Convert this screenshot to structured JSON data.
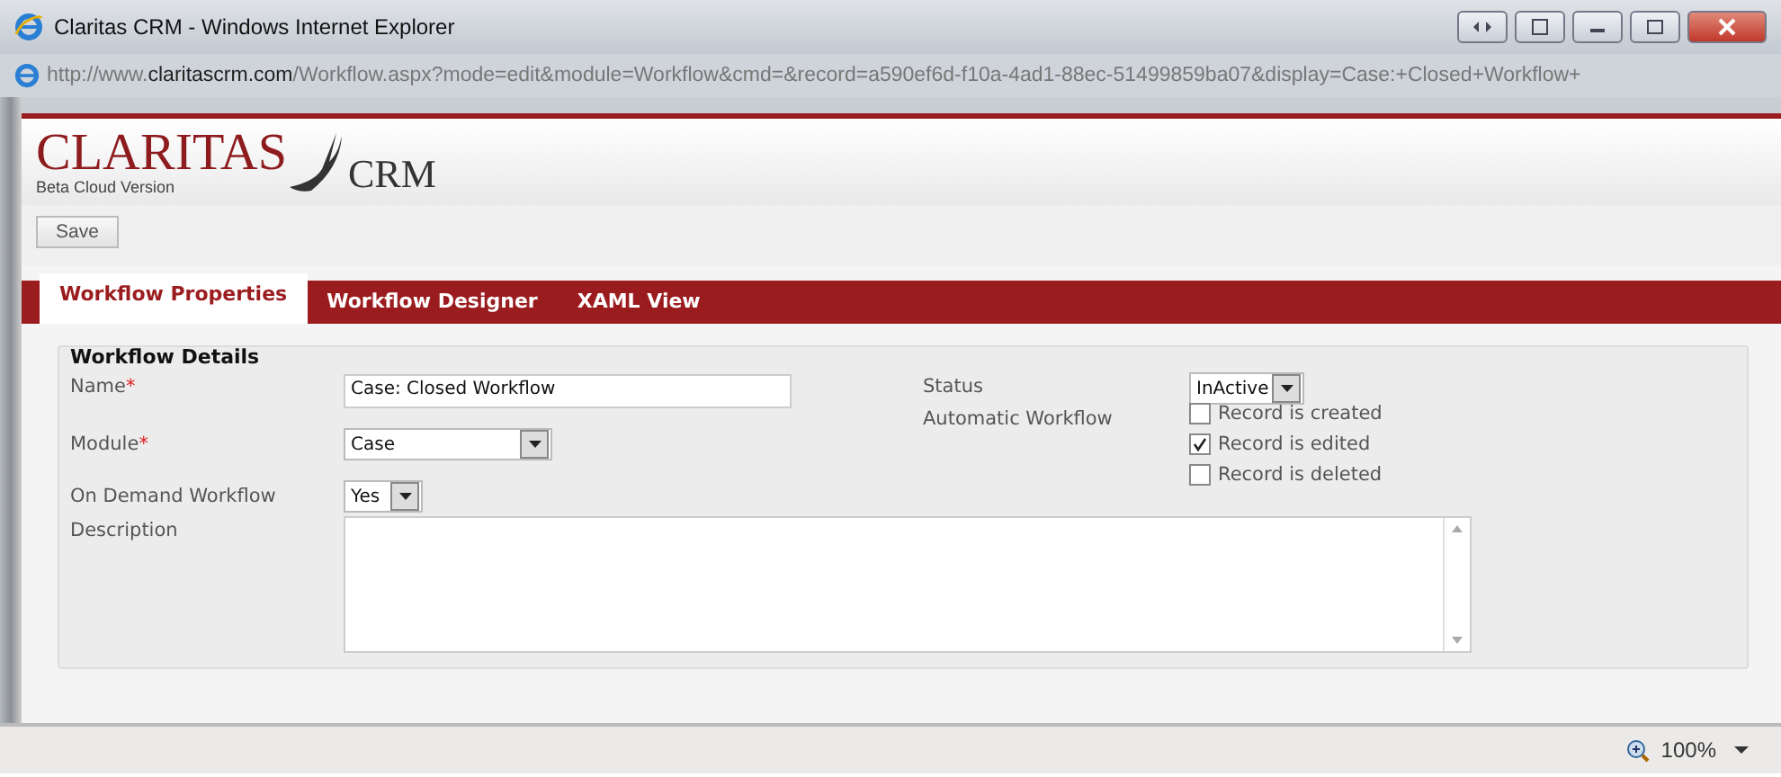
{
  "window": {
    "title": "Claritas CRM - Windows Internet Explorer",
    "address": {
      "prefix": "http://www.",
      "domain": "claritascrm.com",
      "path": "/Workflow.aspx?mode=edit&module=Workflow&cmd=&record=a590ef6d-f10a-4ad1-88ec-51499859ba07&display=Case:+Closed+Workflow+"
    }
  },
  "logo": {
    "name": "CLARITAS",
    "suffix": "CRM",
    "tagline": "Beta Cloud Version"
  },
  "toolbar": {
    "buttons": [
      "Save"
    ]
  },
  "tabs": [
    {
      "label": "Workflow Properties",
      "selected": true
    },
    {
      "label": "Workflow Designer",
      "selected": false
    },
    {
      "label": "XAML View",
      "selected": false
    }
  ],
  "section": {
    "title": "Workflow Details",
    "name": {
      "label": "Name",
      "required_mark": "*",
      "value": "Case: Closed Workflow"
    },
    "module": {
      "label": "Module",
      "required_mark": "*",
      "value": "Case"
    },
    "on_demand": {
      "label": "On Demand Workflow",
      "value": "Yes"
    },
    "description": {
      "label": "Description"
    },
    "status": {
      "label": "Status",
      "value": "InActive"
    },
    "automatic": {
      "label": "Automatic Workflow",
      "options": [
        {
          "label": "Record is created",
          "checked": false
        },
        {
          "label": "Record is edited",
          "checked": true
        },
        {
          "label": "Record is deleted",
          "checked": false
        }
      ]
    }
  },
  "status_bar": {
    "zoom": "100%"
  }
}
